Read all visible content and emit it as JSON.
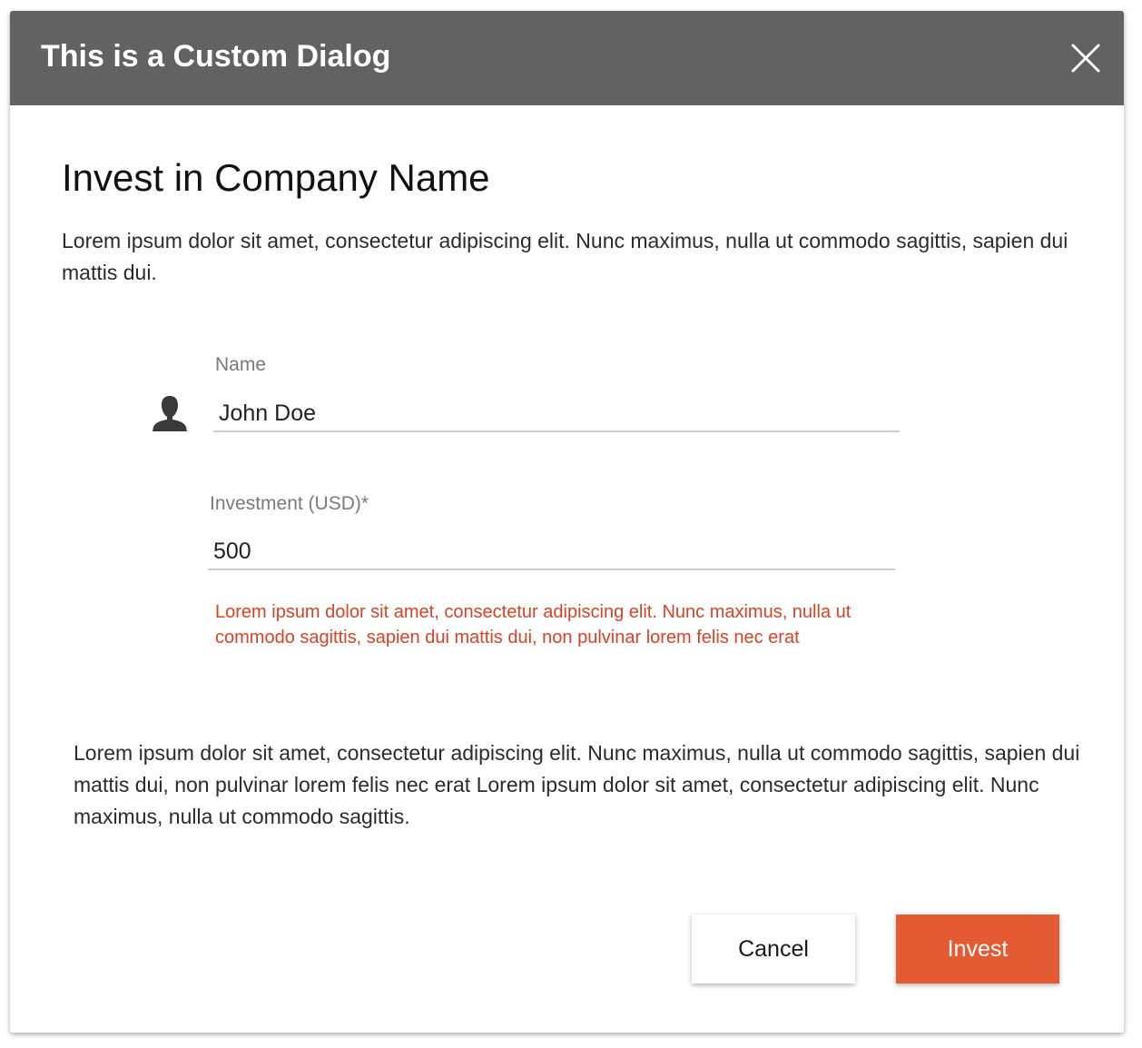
{
  "dialog": {
    "title": "This is a Custom Dialog",
    "close_icon": "close-icon",
    "header_color": "#626262"
  },
  "content": {
    "heading": "Invest in Company Name",
    "intro": "Lorem ipsum dolor sit amet, consectetur adipiscing elit. Nunc maximus, nulla ut commodo sagittis, sapien dui mattis dui.",
    "body": "Lorem ipsum dolor sit amet, consectetur adipiscing elit. Nunc maximus, nulla ut commodo sagittis, sapien dui mattis dui, non pulvinar lorem felis nec erat Lorem ipsum dolor sit amet, consectetur adipiscing elit. Nunc maximus, nulla ut commodo sagittis."
  },
  "form": {
    "name": {
      "label": "Name",
      "value": "John Doe",
      "icon": "user-icon"
    },
    "investment": {
      "label": "Investment  (USD)*",
      "value": "500",
      "error": "Lorem ipsum dolor sit amet, consectetur adipiscing elit. Nunc maximus, nulla ut commodo sagittis, sapien dui mattis dui, non pulvinar lorem felis nec erat",
      "error_color": "#d84325"
    }
  },
  "actions": {
    "cancel_label": "Cancel",
    "invest_label": "Invest",
    "invest_color": "#e45a33"
  }
}
